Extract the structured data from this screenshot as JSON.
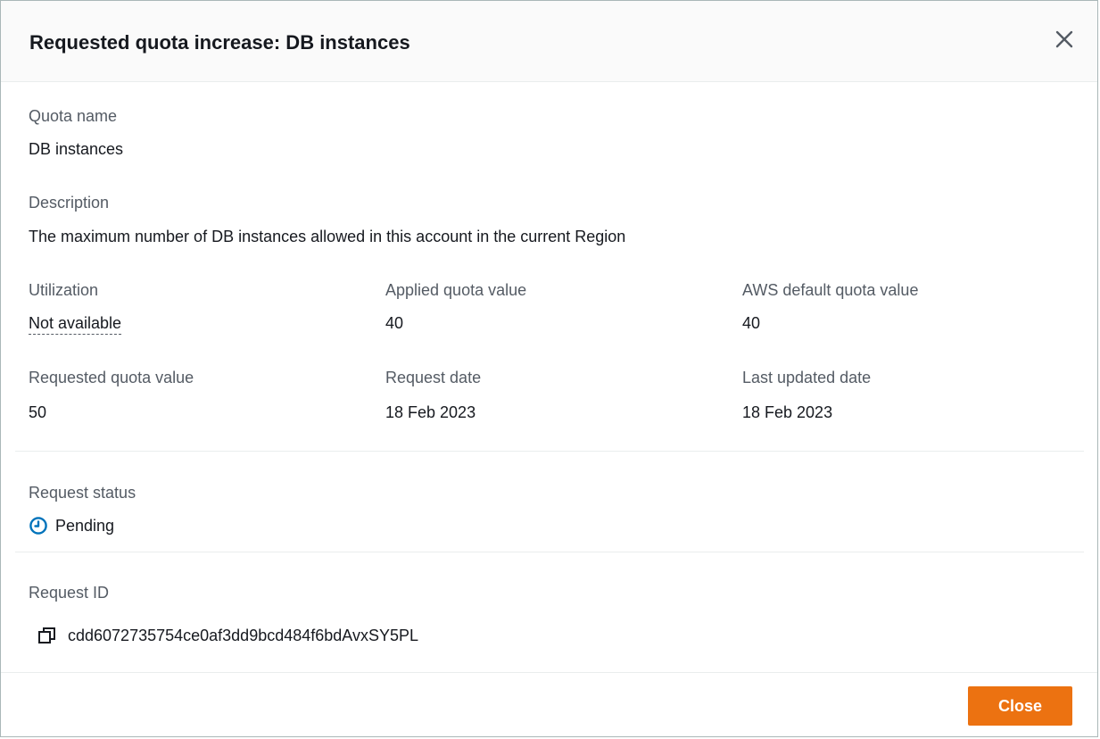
{
  "modal": {
    "title": "Requested quota increase: DB instances"
  },
  "quota_name": {
    "label": "Quota name",
    "value": "DB instances"
  },
  "description": {
    "label": "Description",
    "value": "The maximum number of DB instances allowed in this account in the current Region"
  },
  "utilization": {
    "label": "Utilization",
    "value": "Not available"
  },
  "applied_quota": {
    "label": "Applied quota value",
    "value": "40"
  },
  "default_quota": {
    "label": "AWS default quota value",
    "value": "40"
  },
  "requested_quota": {
    "label": "Requested quota value",
    "value": "50"
  },
  "request_date": {
    "label": "Request date",
    "value": "18 Feb 2023"
  },
  "last_updated": {
    "label": "Last updated date",
    "value": "18 Feb 2023"
  },
  "request_status": {
    "label": "Request status",
    "value": "Pending",
    "icon": "clock-icon",
    "color": "#0073bb"
  },
  "request_id": {
    "label": "Request ID",
    "value": "cdd6072735754ce0af3dd9bcd484f6bdAvxSY5PL",
    "icon": "copy-icon"
  },
  "footer": {
    "close_label": "Close",
    "accent": "#ec7211"
  }
}
